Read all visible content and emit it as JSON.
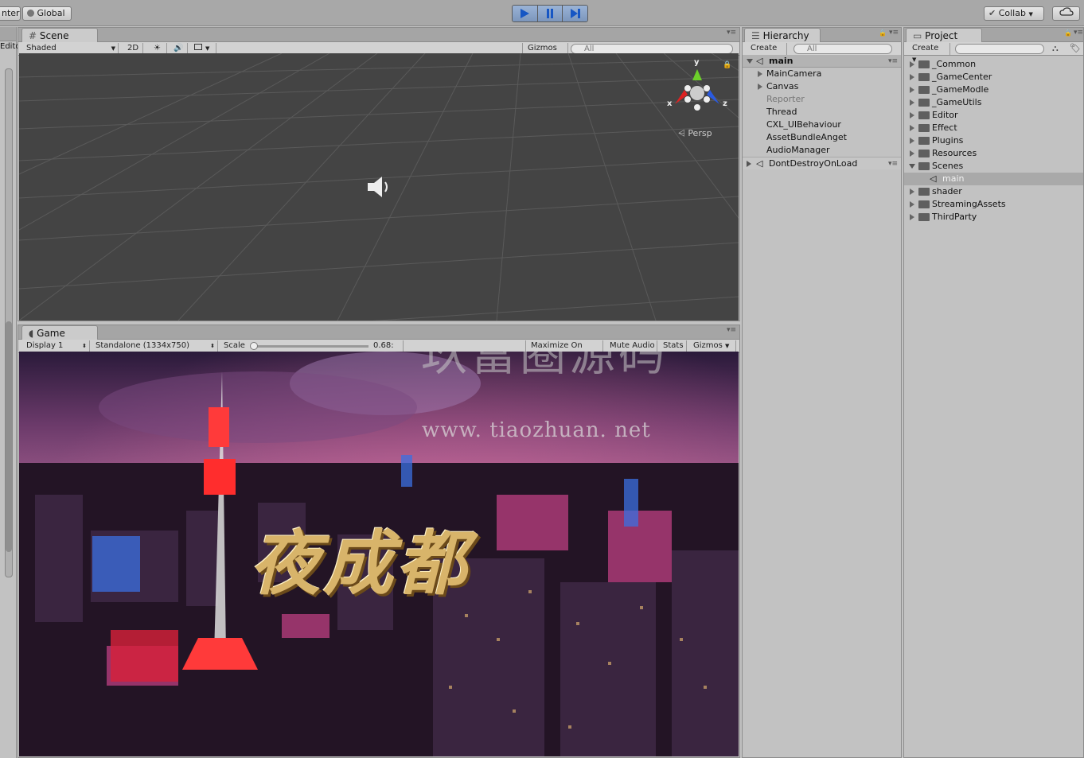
{
  "toolbar": {
    "pivot_label": "nter",
    "global_label": "Global",
    "collab_label": "Collab",
    "play_tooltip": "Play",
    "pause_tooltip": "Pause",
    "step_tooltip": "Step"
  },
  "scene": {
    "tab_label": "Scene",
    "shading_mode": "Shaded",
    "mode_2d": "2D",
    "gizmos_label": "Gizmos",
    "search_placeholder": "All",
    "persp_label": "Persp",
    "axis_x": "x",
    "axis_y": "y",
    "axis_z": "z"
  },
  "game": {
    "tab_label": "Game",
    "display": "Display 1",
    "resolution": "Standalone (1334x750)",
    "scale_label": "Scale",
    "scale_value": "0.68:",
    "scale_level": 0.03,
    "maximize_on_play": "Maximize On Play",
    "mute_audio": "Mute Audio",
    "stats": "Stats",
    "gizmos_label": "Gizmos",
    "title_text": "夜成都",
    "watermark_text": "玖富圈源码",
    "watermark_url": "www. tiaozhuan. net"
  },
  "left_strip": {
    "label": "Edito"
  },
  "hierarchy": {
    "tab_label": "Hierarchy",
    "create_label": "Create",
    "search_placeholder": "All",
    "scene_name": "main",
    "items": [
      {
        "label": "MainCamera",
        "expandable": true,
        "inactive": false
      },
      {
        "label": "Canvas",
        "expandable": true,
        "inactive": false
      },
      {
        "label": "Reporter",
        "expandable": false,
        "inactive": true
      },
      {
        "label": "Thread",
        "expandable": false,
        "inactive": false
      },
      {
        "label": "CXL_UIBehaviour",
        "expandable": false,
        "inactive": false
      },
      {
        "label": "AssetBundleAnget",
        "expandable": false,
        "inactive": false
      },
      {
        "label": "AudioManager",
        "expandable": false,
        "inactive": false
      }
    ],
    "dont_destroy_label": "DontDestroyOnLoad"
  },
  "project": {
    "tab_label": "Project",
    "create_label": "Create",
    "folders": [
      {
        "label": "_Common",
        "expanded": false
      },
      {
        "label": "_GameCenter",
        "expanded": false
      },
      {
        "label": "_GameModle",
        "expanded": false
      },
      {
        "label": "_GameUtils",
        "expanded": false
      },
      {
        "label": "Editor",
        "expanded": false
      },
      {
        "label": "Effect",
        "expanded": false
      },
      {
        "label": "Plugins",
        "expanded": false
      },
      {
        "label": "Resources",
        "expanded": false
      },
      {
        "label": "Scenes",
        "expanded": true
      },
      {
        "label": "main",
        "expanded": false,
        "selected": true
      },
      {
        "label": "shader",
        "expanded": false
      },
      {
        "label": "StreamingAssets",
        "expanded": false
      },
      {
        "label": "ThirdParty",
        "expanded": false
      }
    ]
  },
  "colors": {
    "play_blue": "#2f6fd6",
    "selection_grey": "#a9a9a9",
    "scene_bg": "#444444",
    "title_gold": "#d8b46a"
  }
}
